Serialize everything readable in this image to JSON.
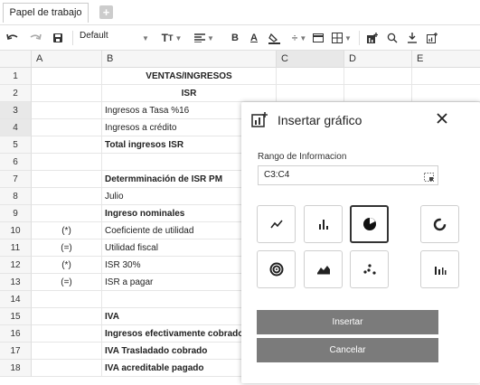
{
  "tabs": {
    "active": "Papel de trabajo"
  },
  "toolbar": {
    "font": "Default"
  },
  "columns": [
    "A",
    "B",
    "C",
    "D",
    "E"
  ],
  "rows": [
    {
      "n": "1",
      "a": "",
      "b": "VENTAS/INGRESOS",
      "bold": true,
      "center": true
    },
    {
      "n": "2",
      "a": "",
      "b": "ISR",
      "bold": true,
      "center": true
    },
    {
      "n": "3",
      "a": "",
      "b": "Ingresos a Tasa %16",
      "bold": false
    },
    {
      "n": "4",
      "a": "",
      "b": "Ingresos a crédito",
      "bold": false
    },
    {
      "n": "5",
      "a": "",
      "b": "Total ingresos ISR",
      "bold": true
    },
    {
      "n": "6",
      "a": "",
      "b": "",
      "bold": false
    },
    {
      "n": "7",
      "a": "",
      "b": "Determminación de ISR PM",
      "bold": true
    },
    {
      "n": "8",
      "a": "",
      "b": "Julio",
      "bold": false
    },
    {
      "n": "9",
      "a": "",
      "b": "Ingreso nominales",
      "bold": true
    },
    {
      "n": "10",
      "a": "(*)",
      "b": "Coeficiente de utilidad",
      "bold": false
    },
    {
      "n": "11",
      "a": "(=)",
      "b": "Utilidad fiscal",
      "bold": false
    },
    {
      "n": "12",
      "a": "(*)",
      "b": "ISR 30%",
      "bold": false
    },
    {
      "n": "13",
      "a": "(=)",
      "b": "ISR a pagar",
      "bold": false
    },
    {
      "n": "14",
      "a": "",
      "b": "",
      "bold": false
    },
    {
      "n": "15",
      "a": "",
      "b": "IVA",
      "bold": true
    },
    {
      "n": "16",
      "a": "",
      "b": "Ingresos efectivamente cobrados",
      "bold": true
    },
    {
      "n": "17",
      "a": "",
      "b": "IVA Trasladado cobrado",
      "bold": true
    },
    {
      "n": "18",
      "a": "",
      "b": "IVA acreditable pagado",
      "bold": true
    }
  ],
  "dialog": {
    "title": "Insertar gráfico",
    "range_label": "Rango de Informacion",
    "range_value": "C3:C4",
    "chart_types": [
      "line",
      "bar",
      "pie",
      "donut",
      "radial",
      "area",
      "scatter",
      "column"
    ],
    "selected_chart": "pie",
    "insert_label": "Insertar",
    "cancel_label": "Cancelar"
  }
}
